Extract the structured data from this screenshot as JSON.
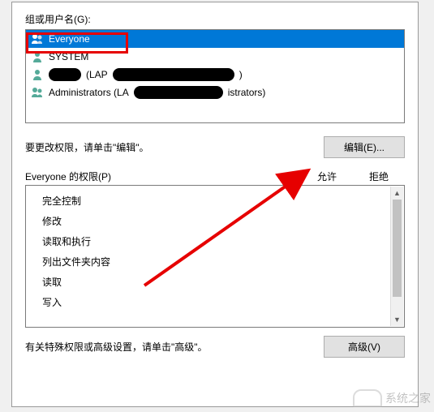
{
  "labels": {
    "groups_or_users": "组或用户名(G):",
    "edit_hint": "要更改权限，请单击\"编辑\"。",
    "edit_button": "编辑(E)...",
    "permissions_for": "Everyone 的权限(P)",
    "allow": "允许",
    "deny": "拒绝",
    "advanced_hint": "有关特殊权限或高级设置，请单击\"高级\"。",
    "advanced_button": "高级(V)"
  },
  "users": [
    {
      "name": "Everyone",
      "selected": true,
      "redacted": false
    },
    {
      "name": "SYSTEM",
      "selected": false,
      "redacted": false
    },
    {
      "name": " (LAP",
      "selected": false,
      "redacted": true,
      "tail": ")"
    },
    {
      "name": "Administrators (LA",
      "selected": false,
      "redacted": true,
      "tail": "istrators)"
    }
  ],
  "permissions": [
    "完全控制",
    "修改",
    "读取和执行",
    "列出文件夹内容",
    "读取",
    "写入"
  ],
  "watermark": "系统之家",
  "annotation": {
    "highlight_color": "#e60000"
  }
}
